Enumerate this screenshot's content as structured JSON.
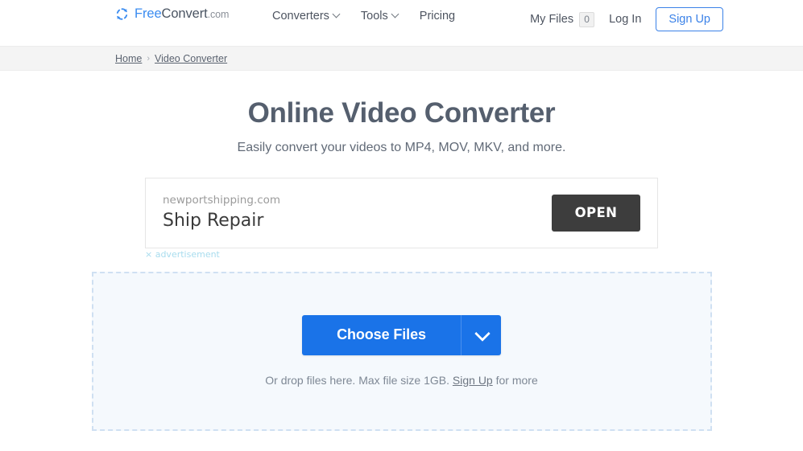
{
  "header": {
    "logo": {
      "icon": "convert-refresh-icon",
      "part_free": "Free",
      "part_convert": "Convert",
      "part_com": ".com"
    },
    "nav": [
      {
        "label": "Converters",
        "has_caret": true,
        "icon": "chevron-down-icon"
      },
      {
        "label": "Tools",
        "has_caret": true,
        "icon": "chevron-down-icon"
      },
      {
        "label": "Pricing",
        "has_caret": false
      }
    ],
    "my_files": {
      "label": "My Files",
      "count": "0"
    },
    "login_label": "Log In",
    "signup_label": "Sign Up"
  },
  "breadcrumb": {
    "items": [
      {
        "label": "Home"
      },
      {
        "label": "Video Converter"
      }
    ],
    "separator": "›"
  },
  "main": {
    "title": "Online Video Converter",
    "subtitle": "Easily convert your videos to MP4, MOV, MKV, and more."
  },
  "advertisement": {
    "domain": "newportshipping.com",
    "headline": "Ship Repair",
    "open_label": "OPEN",
    "ad_label": "× advertisement"
  },
  "dropzone": {
    "choose_files_label": "Choose Files",
    "caret_icon": "chevron-down-icon",
    "hint_prefix": "Or drop files here. Max file size 1GB.",
    "hint_link": "Sign Up",
    "hint_suffix": "for more"
  },
  "colors": {
    "brand_blue": "#3b8cf0",
    "button_blue": "#1a73e8",
    "heading_gray": "#555f6e",
    "ad_button_dark": "#3d3d3d",
    "dropzone_bg": "#f5f9fd",
    "dropzone_border": "#cfe0f2",
    "crumb_bar_bg": "#f4f4f4",
    "ad_label_blue": "#a8dcee"
  }
}
